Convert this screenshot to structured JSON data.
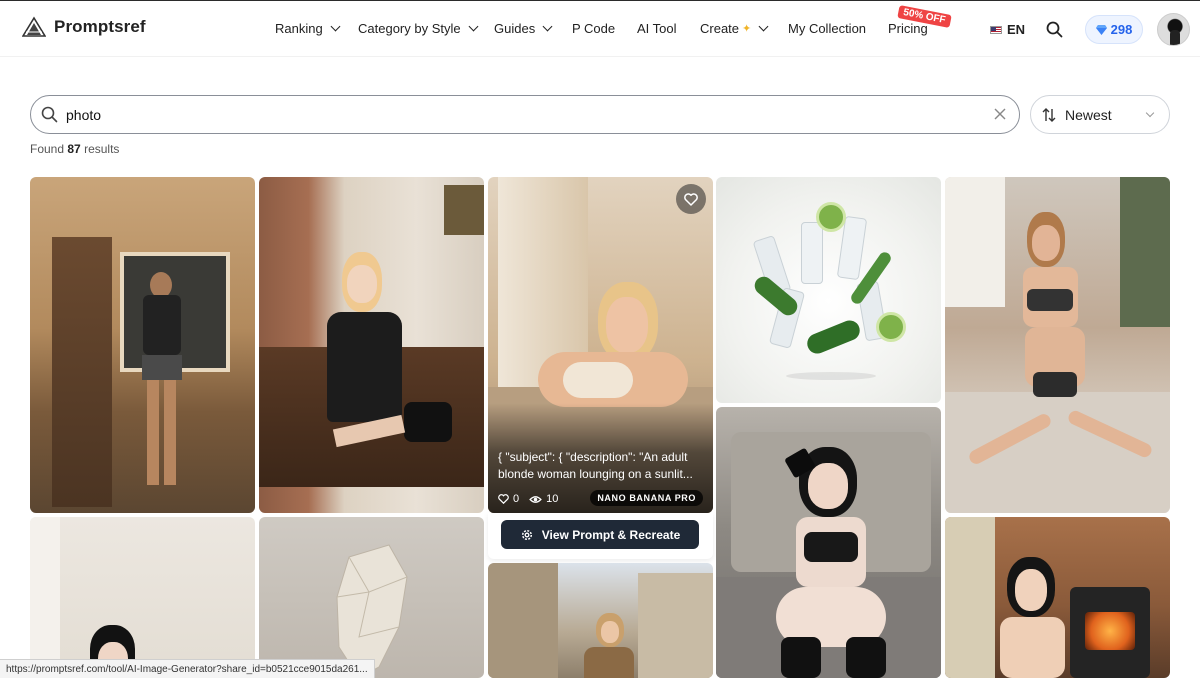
{
  "brand": {
    "name": "Promptsref"
  },
  "nav": {
    "items": [
      {
        "label": "Ranking",
        "dropdown": true
      },
      {
        "label": "Category by Style",
        "dropdown": true
      },
      {
        "label": "Guides",
        "dropdown": true
      },
      {
        "label": "P Code",
        "dropdown": false
      },
      {
        "label": "AI Tool",
        "dropdown": false
      },
      {
        "label": "Create",
        "dropdown": true
      },
      {
        "label": "My Collection",
        "dropdown": false
      },
      {
        "label": "Pricing",
        "dropdown": false
      }
    ],
    "pricing_badge": "50% OFF",
    "language": "EN",
    "credits": "298"
  },
  "search": {
    "value": "photo",
    "placeholder": ""
  },
  "sort": {
    "label": "Newest"
  },
  "results": {
    "prefix": "Found",
    "count": "87",
    "suffix": "results"
  },
  "hover_card": {
    "description": "{ \"subject\": { \"description\": \"An adult blonde woman lounging on a sunlit...",
    "likes": "0",
    "views": "10",
    "model": "NANO BANANA PRO",
    "cta": "View Prompt & Recreate"
  },
  "status_bar": {
    "url": "https://promptsref.com/tool/AI-Image-Generator?share_id=b0521cce9015da261..."
  },
  "colors": {
    "accent": "#2563eb",
    "cta": "#1f2937",
    "badge": "#ef4444"
  }
}
